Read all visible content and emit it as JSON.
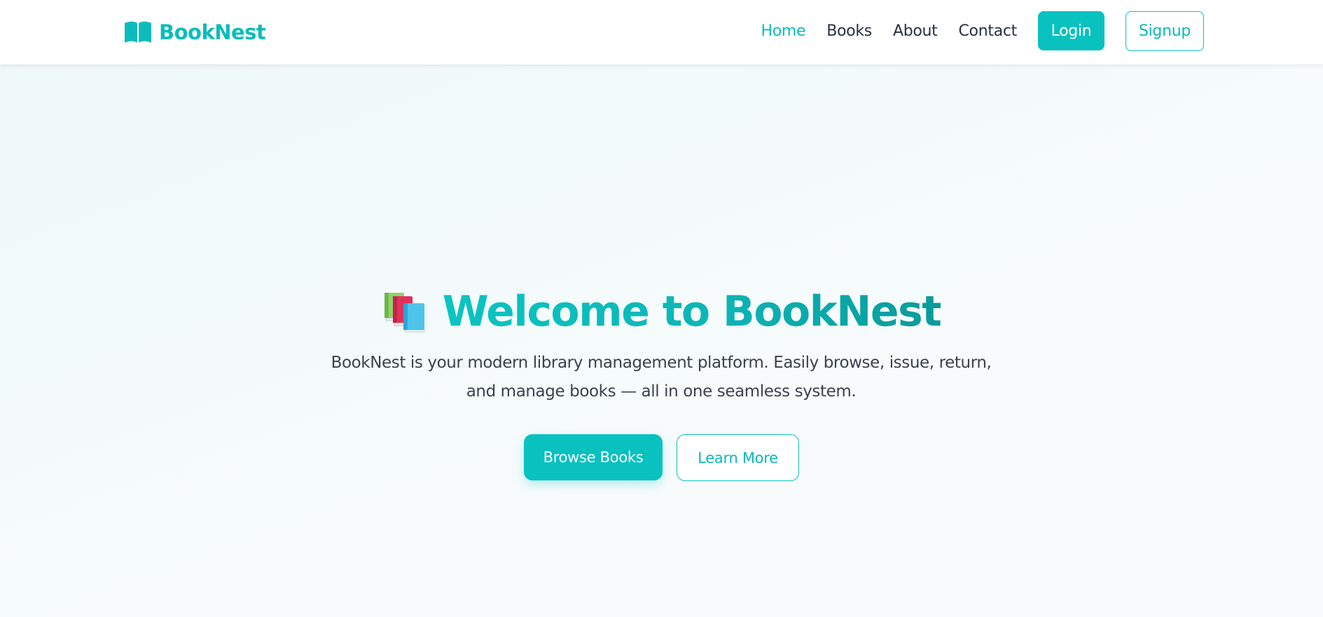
{
  "header": {
    "brand_name": "BookNest",
    "brand_icon": "open-book-icon",
    "nav": [
      {
        "label": "Home",
        "active": true
      },
      {
        "label": "Books",
        "active": false
      },
      {
        "label": "About",
        "active": false
      },
      {
        "label": "Contact",
        "active": false
      }
    ],
    "login_label": "Login",
    "signup_label": "Signup"
  },
  "hero": {
    "icon": "books-stack-icon",
    "title": "Welcome to BookNest",
    "description_line1": "BookNest is your modern library management platform. Easily browse, issue, return,",
    "description_line2": "and manage books — all in one seamless system.",
    "primary_button": "Browse Books",
    "secondary_button": "Learn More"
  },
  "colors": {
    "accent": "#09c1bf",
    "accent_dark": "#0a9a9a",
    "text": "#273142"
  }
}
